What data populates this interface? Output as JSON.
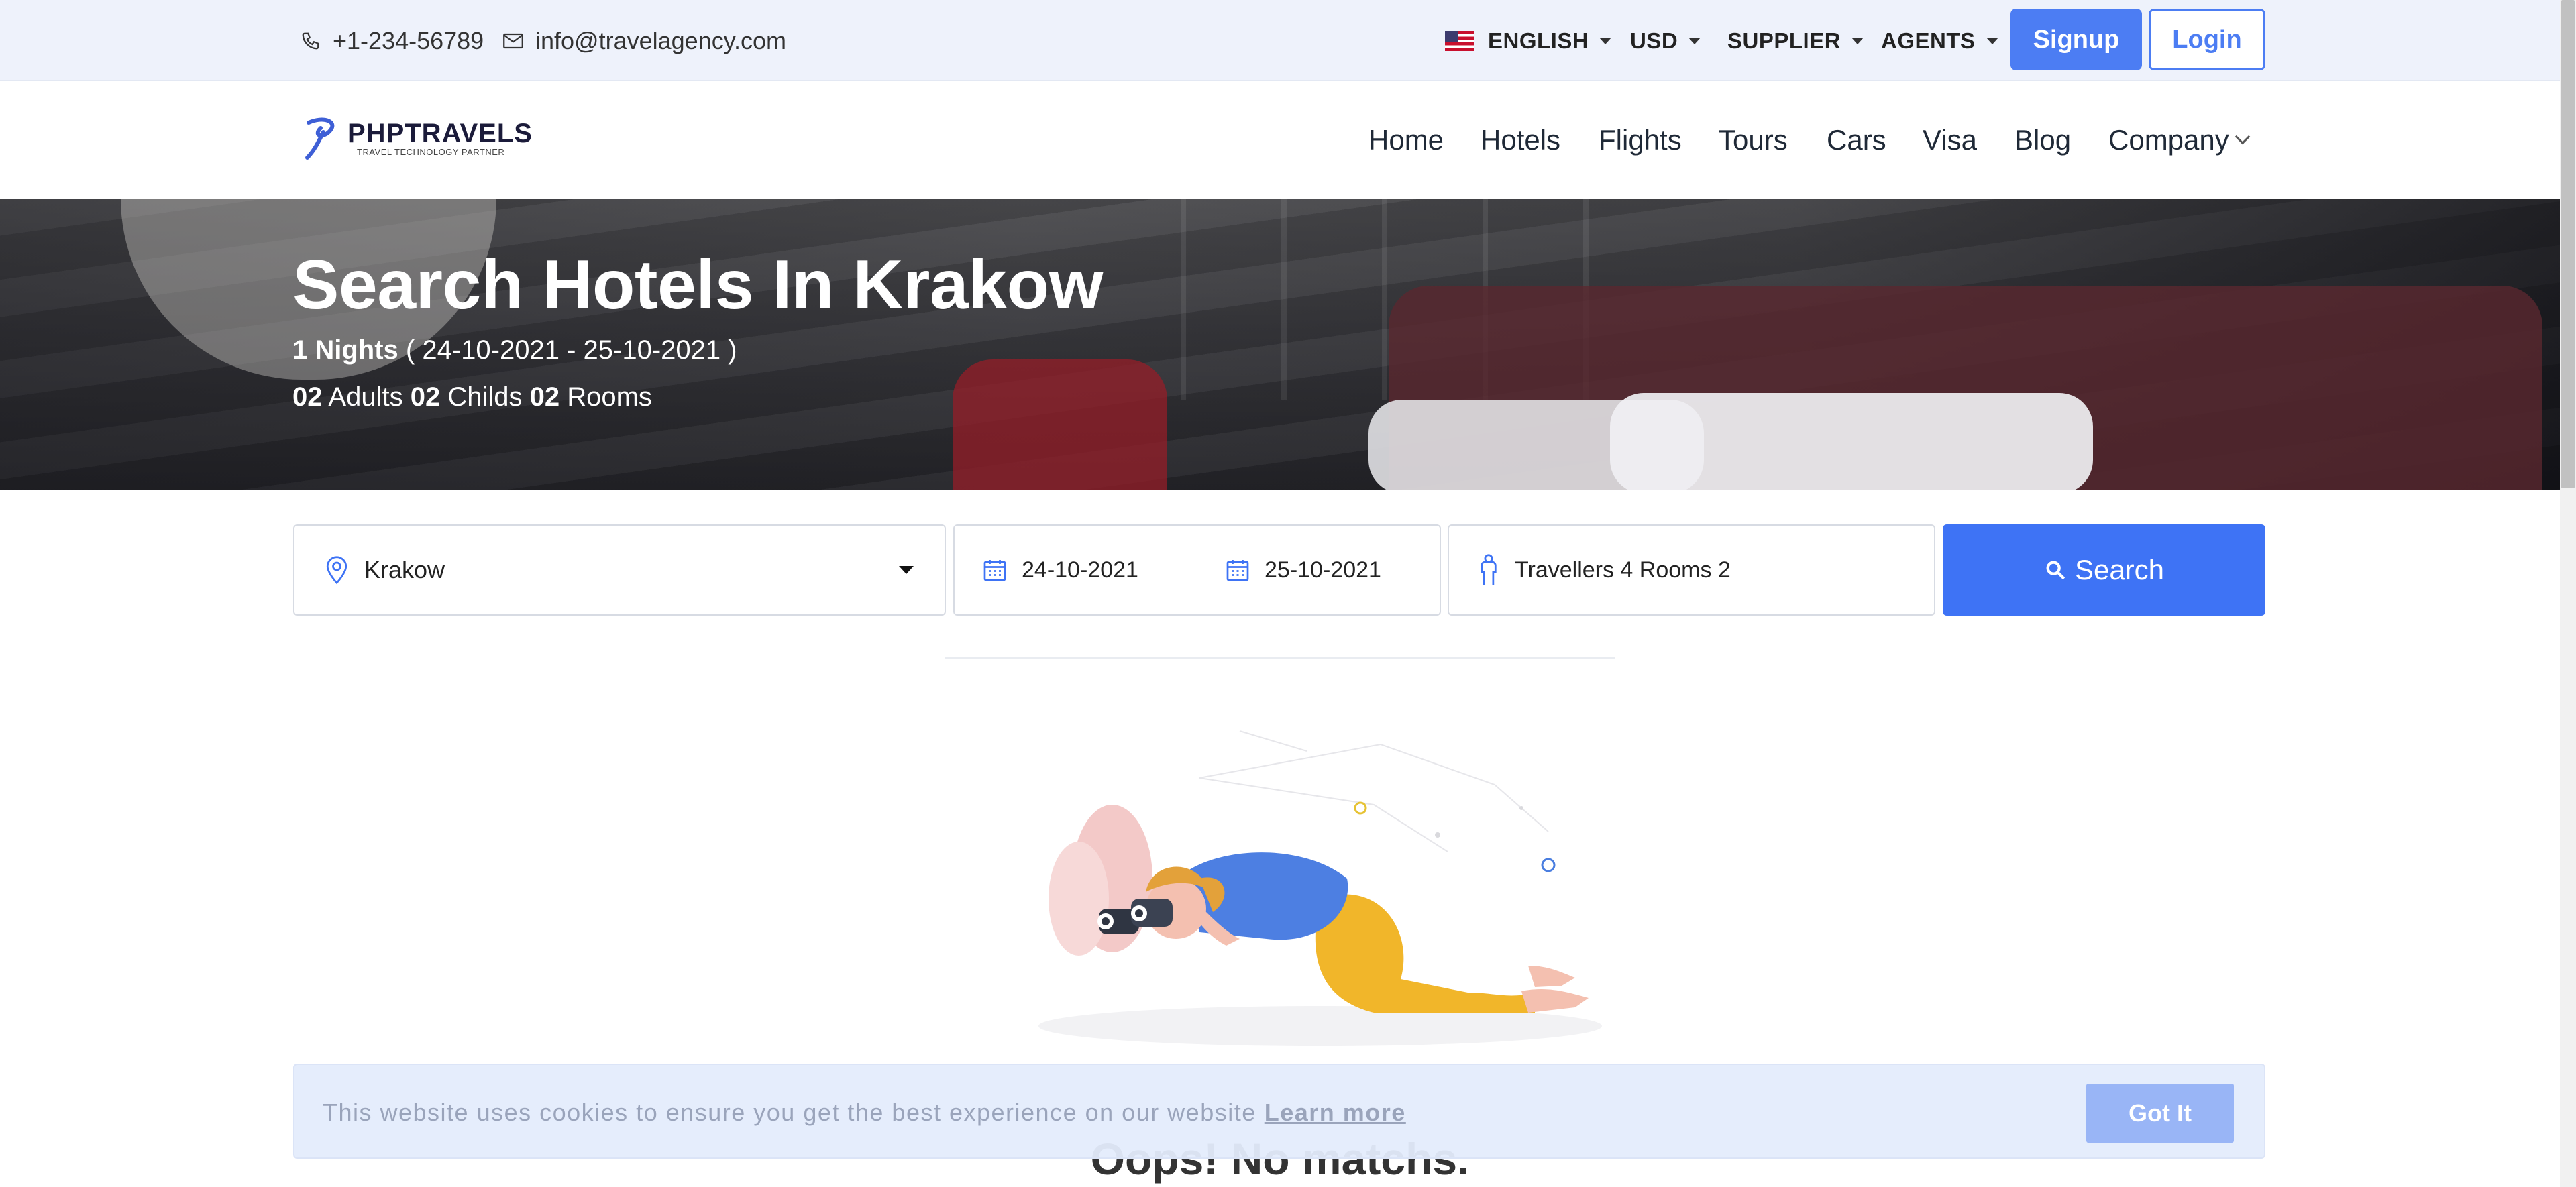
{
  "topbar": {
    "phone": "+1-234-56789",
    "email": "info@travelagency.com",
    "language": "ENGLISH",
    "currency": "USD",
    "supplier": "SUPPLIER",
    "agents": "AGENTS",
    "signup": "Signup",
    "login": "Login"
  },
  "brand": {
    "name": "PHPTRAVELS",
    "tagline": "TRAVEL TECHNOLOGY PARTNER"
  },
  "nav": {
    "items": [
      "Home",
      "Hotels",
      "Flights",
      "Tours",
      "Cars",
      "Visa",
      "Blog",
      "Company"
    ]
  },
  "hero": {
    "title": "Search Hotels In Krakow",
    "nights_count": "1 Nights",
    "dates": "( 24-10-2021 - 25-10-2021 )",
    "adults_count": "02",
    "adults_label": "Adults",
    "childs_count": "02",
    "childs_label": "Childs",
    "rooms_count": "02",
    "rooms_label": "Rooms"
  },
  "search": {
    "city": "Krakow",
    "checkin": "24-10-2021",
    "checkout": "25-10-2021",
    "travellers": "Travellers 4 Rooms 2",
    "button": "Search"
  },
  "results": {
    "empty_title": "Oops! No matchs."
  },
  "cookie": {
    "message": "This website uses cookies to ensure you get the best experience on our website",
    "learn_more": "Learn more",
    "accept": "Got It"
  },
  "colors": {
    "primary": "#4c7df3",
    "search_button": "#3e73f5",
    "topbar_bg": "#eef2fb",
    "cookie_bg": "#e4ecfc"
  },
  "icons": [
    "phone-icon",
    "mail-icon",
    "us-flag-icon",
    "location-pin-icon",
    "calendar-icon",
    "person-icon",
    "search-icon",
    "chevron-down-icon"
  ]
}
